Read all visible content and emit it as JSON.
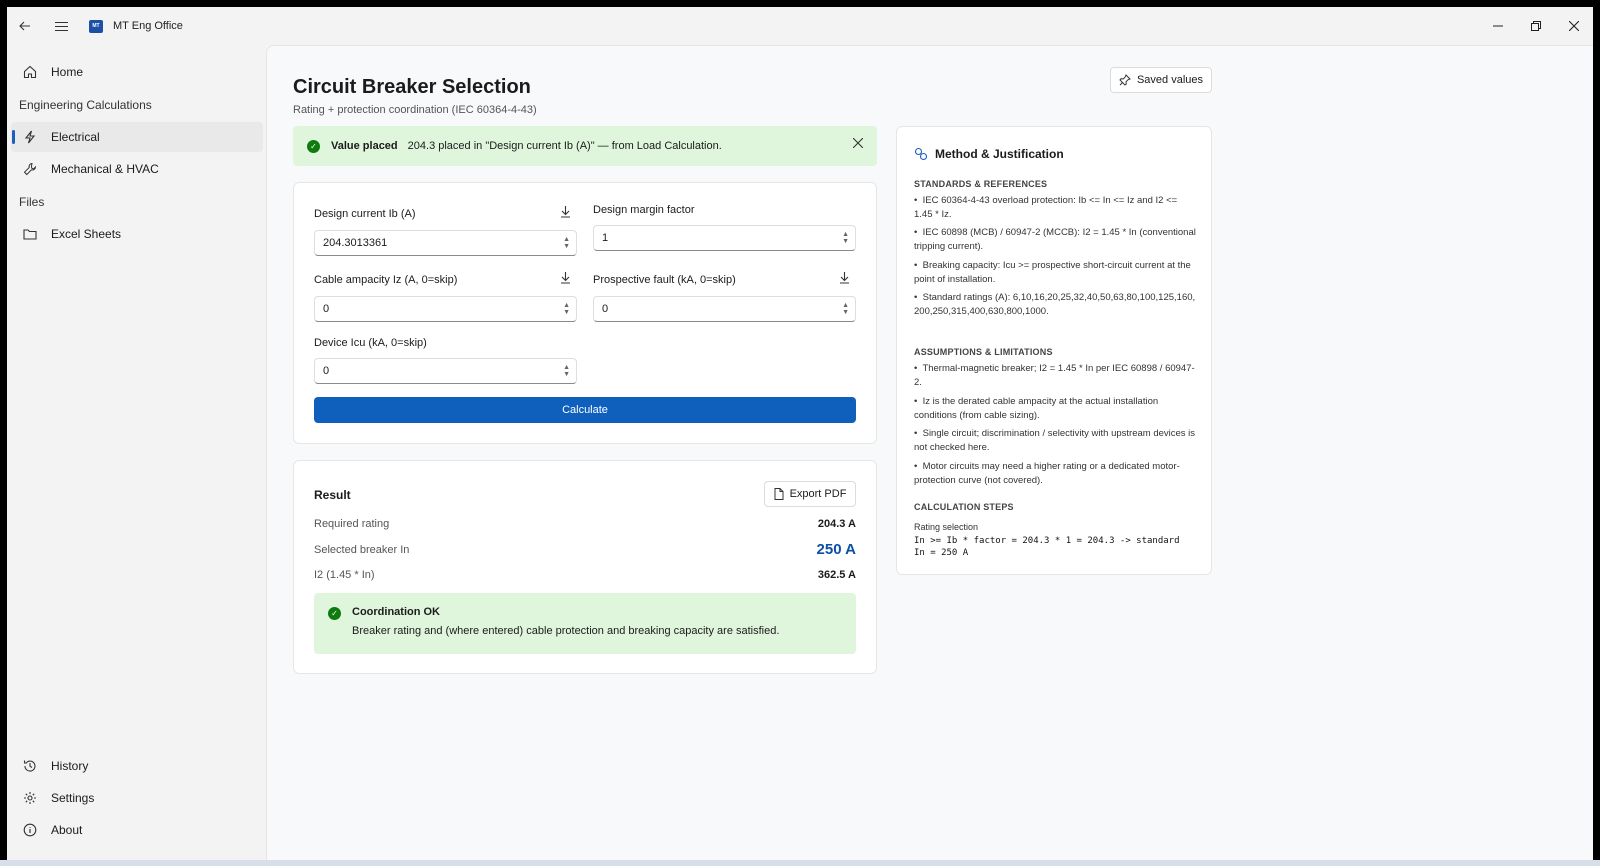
{
  "app": {
    "title": "MT Eng Office",
    "logo_text": "MT"
  },
  "sidebar": {
    "home": "Home",
    "section_eng": "Engineering Calculations",
    "electrical": "Electrical",
    "mech": "Mechanical & HVAC",
    "section_files": "Files",
    "excel": "Excel Sheets",
    "history": "History",
    "settings": "Settings",
    "about": "About"
  },
  "page": {
    "title": "Circuit Breaker Selection",
    "subtitle": "Rating + protection coordination (IEC 60364-4-43)",
    "saved_values": "Saved values"
  },
  "banner": {
    "title": "Value placed",
    "text": "204.3 placed in \"Design current Ib (A)\" — from Load Calculation."
  },
  "inputs": {
    "design_current_label": "Design current Ib (A)",
    "design_current_value": "204.3013361",
    "margin_label": "Design margin factor",
    "margin_value": "1",
    "ampacity_label": "Cable ampacity Iz (A, 0=skip)",
    "ampacity_value": "0",
    "fault_label": "Prospective fault (kA, 0=skip)",
    "fault_value": "0",
    "icu_label": "Device Icu (kA, 0=skip)",
    "icu_value": "0",
    "calculate": "Calculate"
  },
  "result": {
    "title": "Result",
    "export": "Export PDF",
    "required_label": "Required rating",
    "required_value": "204.3 A",
    "selected_label": "Selected breaker In",
    "selected_value": "250 A",
    "i2_label": "I2 (1.45 * In)",
    "i2_value": "362.5 A",
    "ok_title": "Coordination OK",
    "ok_text": "Breaker rating and (where entered) cable protection and breaking capacity are satisfied."
  },
  "method": {
    "title": "Method & Justification",
    "sec_standards": "STANDARDS & REFERENCES",
    "s1": "IEC 60364-4-43 overload protection:  Ib <= In <= Iz  and I2 <= 1.45 * Iz.",
    "s2": "IEC 60898 (MCB) / 60947-2 (MCCB):  I2 = 1.45 * In (conventional tripping current).",
    "s3": "Breaking capacity:  Icu >= prospective short-circuit current at the point of installation.",
    "s4": "Standard ratings (A): 6,10,16,20,25,32,40,50,63,80,100,125,160,200,250,315,400,630,800,1000.",
    "sec_assumptions": "ASSUMPTIONS & LIMITATIONS",
    "a1": "Thermal-magnetic breaker; I2 = 1.45 * In per IEC 60898 / 60947-2.",
    "a2": "Iz is the derated cable ampacity at the actual installation conditions (from cable sizing).",
    "a3": "Single circuit; discrimination / selectivity with upstream devices is not checked here.",
    "a4": "Motor circuits may need a higher rating or a dedicated motor-protection curve (not covered).",
    "sec_steps": "CALCULATION STEPS",
    "step_title": "Rating selection",
    "step_formula": "In >= Ib * factor = 204.3 * 1 = 204.3 -> standard\nIn = 250 A"
  },
  "colors": {
    "accent": "#0f5fbd",
    "success_bg": "#dff6dd",
    "success": "#0f7b0f"
  }
}
